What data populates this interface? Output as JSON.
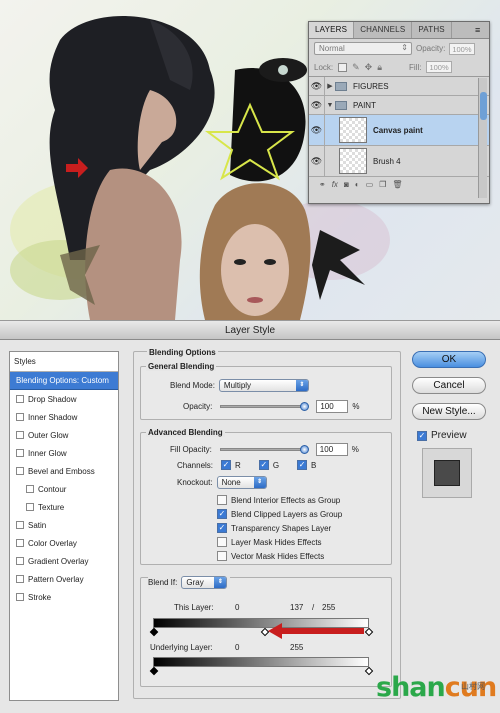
{
  "layers_panel": {
    "tabs": [
      "LAYERS",
      "CHANNELS",
      "PATHS"
    ],
    "active_tab": "LAYERS",
    "blend_mode": "Normal",
    "opacity_label": "Opacity:",
    "opacity_value": "100%",
    "lock_label": "Lock:",
    "fill_label": "Fill:",
    "fill_value": "100%",
    "layers": [
      {
        "name": "FIGURES",
        "type": "group",
        "expanded": false
      },
      {
        "name": "PAINT",
        "type": "group",
        "expanded": true
      },
      {
        "name": "Canvas paint",
        "type": "layer",
        "selected": true
      },
      {
        "name": "Brush 4",
        "type": "layer",
        "selected": false
      }
    ]
  },
  "dialog": {
    "title": "Layer Style",
    "styles_header": "Styles",
    "styles": [
      {
        "label": "Blending Options: Custom",
        "selected": true,
        "checkbox": false,
        "sub": false
      },
      {
        "label": "Drop Shadow",
        "checkbox": true,
        "sub": false
      },
      {
        "label": "Inner Shadow",
        "checkbox": true,
        "sub": false
      },
      {
        "label": "Outer Glow",
        "checkbox": true,
        "sub": false
      },
      {
        "label": "Inner Glow",
        "checkbox": true,
        "sub": false
      },
      {
        "label": "Bevel and Emboss",
        "checkbox": true,
        "sub": false
      },
      {
        "label": "Contour",
        "checkbox": true,
        "sub": true
      },
      {
        "label": "Texture",
        "checkbox": true,
        "sub": true
      },
      {
        "label": "Satin",
        "checkbox": true,
        "sub": false
      },
      {
        "label": "Color Overlay",
        "checkbox": true,
        "sub": false
      },
      {
        "label": "Gradient Overlay",
        "checkbox": true,
        "sub": false
      },
      {
        "label": "Pattern Overlay",
        "checkbox": true,
        "sub": false
      },
      {
        "label": "Stroke",
        "checkbox": true,
        "sub": false
      }
    ],
    "blending_options_title": "Blending Options",
    "general": {
      "title": "General Blending",
      "blend_mode_label": "Blend Mode:",
      "blend_mode_value": "Multiply",
      "opacity_label": "Opacity:",
      "opacity_value": "100",
      "opacity_unit": "%",
      "opacity_fraction": 1.0
    },
    "advanced": {
      "title": "Advanced Blending",
      "fill_opacity_label": "Fill Opacity:",
      "fill_opacity_value": "100",
      "fill_opacity_unit": "%",
      "channels_label": "Channels:",
      "channels": [
        {
          "label": "R",
          "checked": true
        },
        {
          "label": "G",
          "checked": true
        },
        {
          "label": "B",
          "checked": true
        }
      ],
      "knockout_label": "Knockout:",
      "knockout_value": "None",
      "options": [
        {
          "label": "Blend Interior Effects as Group",
          "checked": false
        },
        {
          "label": "Blend Clipped Layers as Group",
          "checked": true
        },
        {
          "label": "Transparency Shapes Layer",
          "checked": true
        },
        {
          "label": "Layer Mask Hides Effects",
          "checked": false
        },
        {
          "label": "Vector Mask Hides Effects",
          "checked": false
        }
      ]
    },
    "blend_if": {
      "label": "Blend If:",
      "value": "Gray",
      "this_layer_label": "This Layer:",
      "this_layer_low": "0",
      "this_layer_high_split": "137",
      "this_layer_separator": "/",
      "this_layer_high": "255",
      "underlying_label": "Underlying Layer:",
      "underlying_low": "0",
      "underlying_high": "255"
    },
    "buttons": {
      "ok": "OK",
      "cancel": "Cancel",
      "new_style": "New Style..."
    },
    "preview_label": "Preview",
    "preview_checked": true
  },
  "watermark": {
    "main_a": "shan",
    "main_b": "cun",
    "sub": "山村网"
  },
  "colors": {
    "accent": "#3d7bd3",
    "arrow": "#c81e1e",
    "watermark_green": "#2ba84a"
  }
}
